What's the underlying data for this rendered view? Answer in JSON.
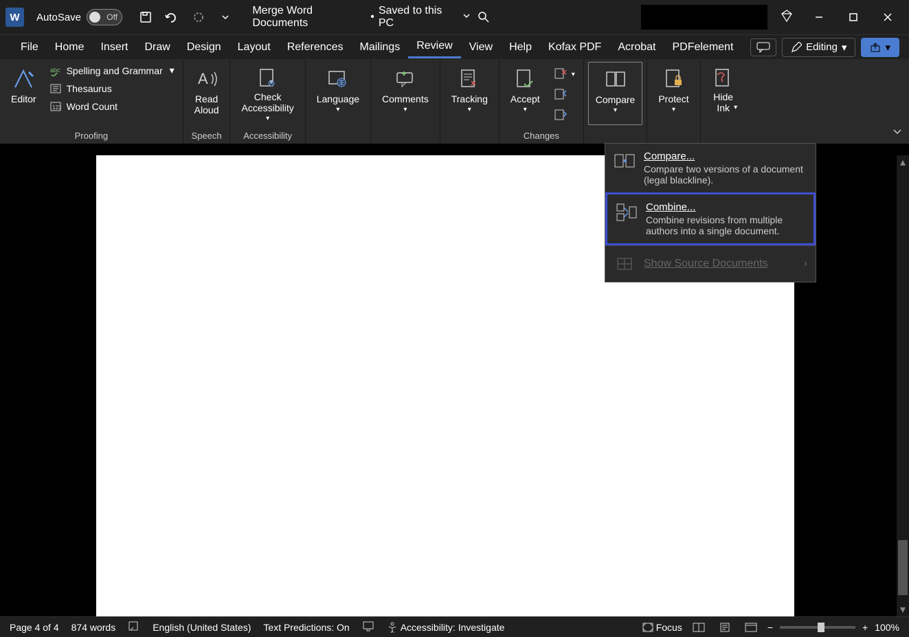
{
  "title_bar": {
    "autosave_label": "AutoSave",
    "autosave_state": "Off",
    "doc_name": "Merge Word Documents",
    "save_status": "Saved to this PC"
  },
  "tabs": [
    "File",
    "Home",
    "Insert",
    "Draw",
    "Design",
    "Layout",
    "References",
    "Mailings",
    "Review",
    "View",
    "Help",
    "Kofax PDF",
    "Acrobat",
    "PDFelement"
  ],
  "active_tab": "Review",
  "editing_mode": "Editing",
  "ribbon": {
    "editor": "Editor",
    "spelling": "Spelling and Grammar",
    "thesaurus": "Thesaurus",
    "word_count": "Word Count",
    "group_proofing": "Proofing",
    "read_aloud": "Read\nAloud",
    "group_speech": "Speech",
    "check_accessibility": "Check\nAccessibility",
    "group_accessibility": "Accessibility",
    "language": "Language",
    "comments": "Comments",
    "tracking": "Tracking",
    "accept": "Accept",
    "group_changes": "Changes",
    "compare": "Compare",
    "protect": "Protect",
    "hide_ink": "Hide\nInk"
  },
  "dropdown": {
    "compare_title": "Compare...",
    "compare_desc": "Compare two versions of a document (legal blackline).",
    "combine_title": "Combine...",
    "combine_desc": "Combine revisions from multiple authors into a single document.",
    "show_source": "Show Source Documents"
  },
  "status": {
    "page": "Page 4 of 4",
    "words": "874 words",
    "language": "English (United States)",
    "predictions": "Text Predictions: On",
    "accessibility": "Accessibility: Investigate",
    "focus": "Focus",
    "zoom": "100%"
  }
}
